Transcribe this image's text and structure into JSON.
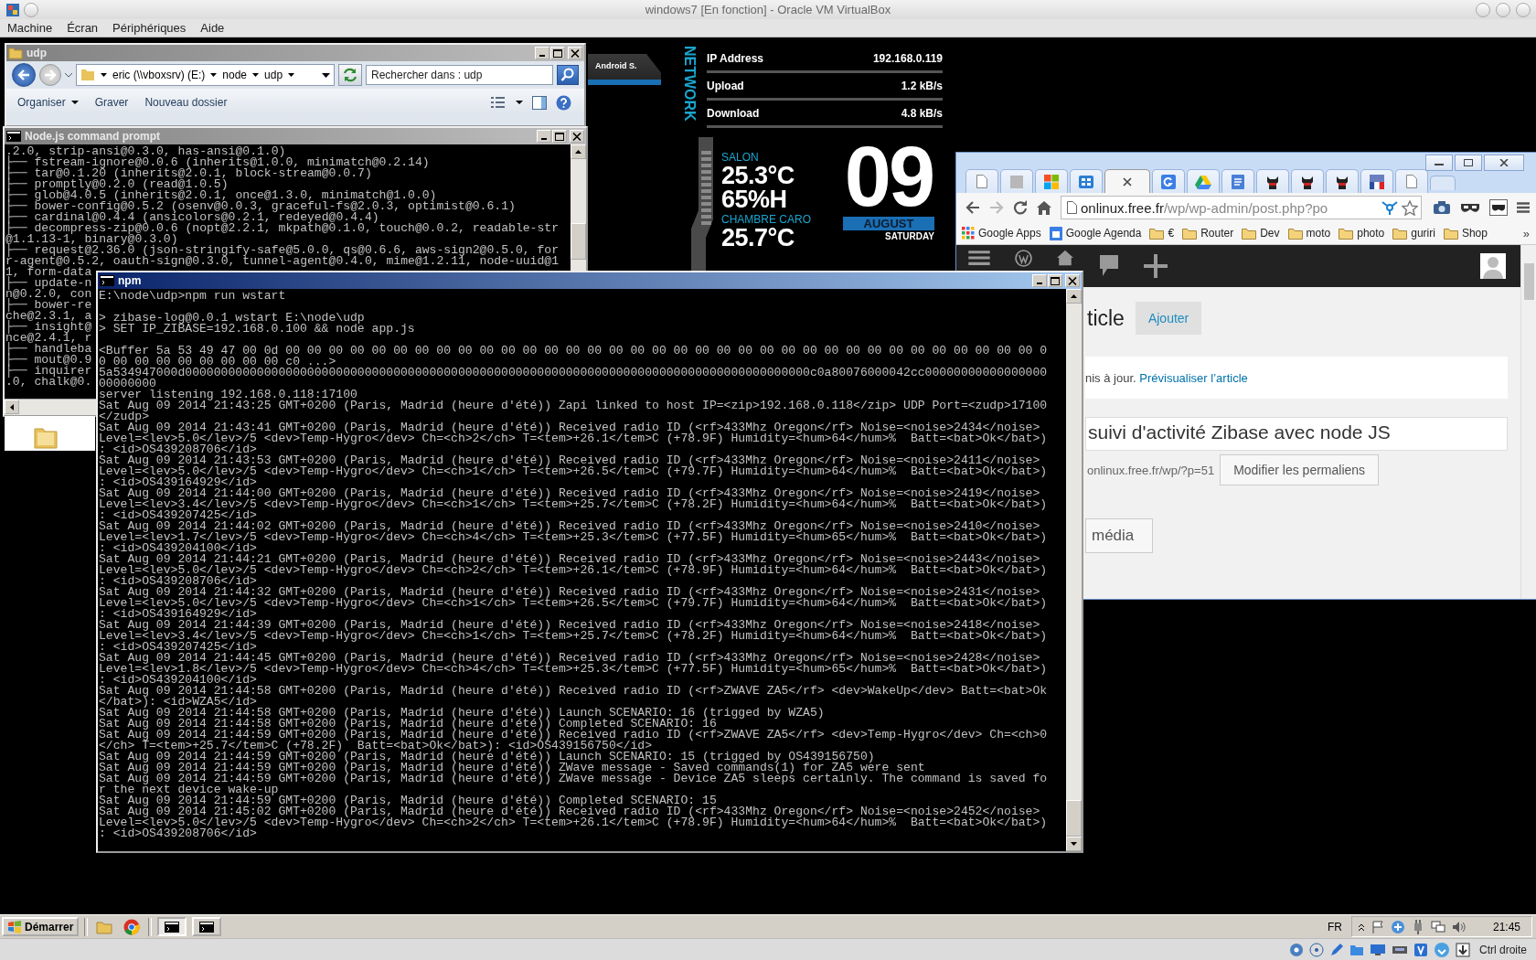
{
  "host_window": {
    "title": "windows7 [En fonction] - Oracle VM VirtualBox",
    "menu": [
      "Machine",
      "Écran",
      "Périphériques",
      "Aide"
    ]
  },
  "explorer": {
    "title": "udp",
    "breadcrumb": [
      "eric (\\\\vboxsrv) (E:)",
      "node",
      "udp"
    ],
    "search": {
      "placeholder": "Rechercher dans : udp"
    },
    "toolbar": [
      {
        "label": "Organiser",
        "dropdown": true
      },
      {
        "label": "Graver",
        "dropdown": false
      },
      {
        "label": "Nouveau dossier",
        "dropdown": false
      }
    ]
  },
  "node_prompt": {
    "title": "Node.js command prompt",
    "lines": [
      ".2.0, strip-ansi@0.3.0, has-ansi@0.1.0)",
      "├── fstream-ignore@0.0.6 (inherits@1.0.0, minimatch@0.2.14)",
      "├── tar@0.1.20 (inherits@2.0.1, block-stream@0.0.7)",
      "├── promptly@0.2.0 (read@1.0.5)",
      "├── glob@4.0.5 (inherits@2.0.1, once@1.3.0, minimatch@1.0.0)",
      "├── bower-config@0.5.2 (osenv@0.0.3, graceful-fs@2.0.3, optimist@0.6.1)",
      "├── cardinal@0.4.4 (ansicolors@0.2.1, redeyed@0.4.4)",
      "├── decompress-zip@0.0.6 (nopt@2.2.1, mkpath@0.1.0, touch@0.0.2, readable-str",
      "@1.1.13-1, binary@0.3.0)",
      "├── request@2.36.0 (json-stringify-safe@5.0.0, qs@0.6.6, aws-sign2@0.5.0, for",
      "r-agent@0.5.2, oauth-sign@0.3.0, tunnel-agent@0.4.0, mime@1.2.11, node-uuid@1",
      "1, form-data",
      "├── update-n",
      "n@0.2.0, con",
      "├── bower-re",
      "che@2.3.1, a",
      "├── insight@",
      "nce@2.4.1, r",
      "├── handleba",
      "├── mout@0.9",
      "├── inquirer",
      ".0, chalk@0."
    ]
  },
  "npm_console": {
    "title": "npm",
    "blocks": [
      [
        "E:\\node\\udp>npm run wstart"
      ],
      [
        "> zibase-log@0.0.1 wstart E:\\node\\udp",
        "> SET IP_ZIBASE=192.168.0.100 && node app.js"
      ],
      [
        "<Buffer 5a 53 49 47 00 0d 00 00 00 00 00 00 00 00 00 00 00 00 00 00 00 00 00 00 00 00 00 00 00 00 00 00 00 00 00 00 00 00 00 00 00 0",
        "0 00 00 00 00 00 00 00 00 c0 ...>",
        "5a534947000d000000000000000000000000000000000000000000000000000000000000000000000000000000000000000c0a80076000042cc00000000000000000",
        "00000000",
        "server listening 192.168.0.118:17100",
        "Sat Aug 09 2014 21:43:25 GMT+0200 (Paris, Madrid (heure d'été)) Zapi linked to host IP=<zip>192.168.0.118</zip> UDP Port=<zudp>17100",
        "</zudp>",
        "Sat Aug 09 2014 21:43:41 GMT+0200 (Paris, Madrid (heure d'été)) Received radio ID (<rf>433Mhz Oregon</rf> Noise=<noise>2434</noise>",
        "Level=<lev>5.0</lev>/5 <dev>Temp-Hygro</dev> Ch=<ch>2</ch> T=<tem>+26.1</tem>C (+78.9F) Humidity=<hum>64</hum>%  Batt=<bat>Ok</bat>)",
        ": <id>OS439208706</id>",
        "Sat Aug 09 2014 21:43:53 GMT+0200 (Paris, Madrid (heure d'été)) Received radio ID (<rf>433Mhz Oregon</rf> Noise=<noise>2411</noise>",
        "Level=<lev>5.0</lev>/5 <dev>Temp-Hygro</dev> Ch=<ch>1</ch> T=<tem>+26.5</tem>C (+79.7F) Humidity=<hum>64</hum>%  Batt=<bat>Ok</bat>)",
        ": <id>OS439164929</id>",
        "Sat Aug 09 2014 21:44:00 GMT+0200 (Paris, Madrid (heure d'été)) Received radio ID (<rf>433Mhz Oregon</rf> Noise=<noise>2419</noise>",
        "Level=<lev>3.4</lev>/5 <dev>Temp-Hygro</dev> Ch=<ch>1</ch> T=<tem>+25.7</tem>C (+78.2F) Humidity=<hum>64</hum>%  Batt=<bat>Ok</bat>)",
        ": <id>OS439207425</id>",
        "Sat Aug 09 2014 21:44:02 GMT+0200 (Paris, Madrid (heure d'été)) Received radio ID (<rf>433Mhz Oregon</rf> Noise=<noise>2410</noise>",
        "Level=<lev>1.7</lev>/5 <dev>Temp-Hygro</dev> Ch=<ch>4</ch> T=<tem>+25.3</tem>C (+77.5F) Humidity=<hum>65</hum>%  Batt=<bat>Ok</bat>)",
        ": <id>OS439204100</id>",
        "Sat Aug 09 2014 21:44:21 GMT+0200 (Paris, Madrid (heure d'été)) Received radio ID (<rf>433Mhz Oregon</rf> Noise=<noise>2443</noise>",
        "Level=<lev>5.0</lev>/5 <dev>Temp-Hygro</dev> Ch=<ch>2</ch> T=<tem>+26.1</tem>C (+78.9F) Humidity=<hum>64</hum>%  Batt=<bat>Ok</bat>)",
        ": <id>OS439208706</id>",
        "Sat Aug 09 2014 21:44:32 GMT+0200 (Paris, Madrid (heure d'été)) Received radio ID (<rf>433Mhz Oregon</rf> Noise=<noise>2431</noise>",
        "Level=<lev>5.0</lev>/5 <dev>Temp-Hygro</dev> Ch=<ch>1</ch> T=<tem>+26.5</tem>C (+79.7F) Humidity=<hum>64</hum>%  Batt=<bat>Ok</bat>)",
        ": <id>OS439164929</id>",
        "Sat Aug 09 2014 21:44:39 GMT+0200 (Paris, Madrid (heure d'été)) Received radio ID (<rf>433Mhz Oregon</rf> Noise=<noise>2418</noise>",
        "Level=<lev>3.4</lev>/5 <dev>Temp-Hygro</dev> Ch=<ch>1</ch> T=<tem>+25.7</tem>C (+78.2F) Humidity=<hum>64</hum>%  Batt=<bat>Ok</bat>)",
        ": <id>OS439207425</id>",
        "Sat Aug 09 2014 21:44:45 GMT+0200 (Paris, Madrid (heure d'été)) Received radio ID (<rf>433Mhz Oregon</rf> Noise=<noise>2428</noise>",
        "Level=<lev>1.8</lev>/5 <dev>Temp-Hygro</dev> Ch=<ch>4</ch> T=<tem>+25.3</tem>C (+77.5F) Humidity=<hum>65</hum>%  Batt=<bat>Ok</bat>)",
        ": <id>OS439204100</id>",
        "Sat Aug 09 2014 21:44:58 GMT+0200 (Paris, Madrid (heure d'été)) Received radio ID (<rf>ZWAVE ZA5</rf> <dev>WakeUp</dev> Batt=<bat>Ok",
        "</bat>): <id>WZA5</id>",
        "Sat Aug 09 2014 21:44:58 GMT+0200 (Paris, Madrid (heure d'été)) Launch SCENARIO: 16 (trigged by WZA5)",
        "Sat Aug 09 2014 21:44:58 GMT+0200 (Paris, Madrid (heure d'été)) Completed SCENARIO: 16",
        "Sat Aug 09 2014 21:44:59 GMT+0200 (Paris, Madrid (heure d'été)) Received radio ID (<rf>ZWAVE ZA5</rf> <dev>Temp-Hygro</dev> Ch=<ch>0",
        "</ch> T=<tem>+25.7</tem>C (+78.2F)  Batt=<bat>Ok</bat>): <id>OS439156750</id>",
        "Sat Aug 09 2014 21:44:59 GMT+0200 (Paris, Madrid (heure d'été)) Launch SCENARIO: 15 (trigged by OS439156750)",
        "Sat Aug 09 2014 21:44:59 GMT+0200 (Paris, Madrid (heure d'été)) ZWave message - Saved commands(1) for ZA5 were sent",
        "Sat Aug 09 2014 21:44:59 GMT+0200 (Paris, Madrid (heure d'été)) ZWave message - Device ZA5 sleeps certainly. The command is saved fo",
        "r the next device wake-up",
        "Sat Aug 09 2014 21:44:59 GMT+0200 (Paris, Madrid (heure d'été)) Completed SCENARIO: 15",
        "Sat Aug 09 2014 21:45:02 GMT+0200 (Paris, Madrid (heure d'été)) Received radio ID (<rf>433Mhz Oregon</rf> Noise=<noise>2452</noise>",
        "Level=<lev>5.0</lev>/5 <dev>Temp-Hygro</dev> Ch=<ch>2</ch> T=<tem>+26.1</tem>C (+78.9F) Humidity=<hum>64</hum>%  Batt=<bat>Ok</bat>)",
        ": <id>OS439208706</id>"
      ]
    ]
  },
  "device_tag": "Android S.",
  "network_widget": {
    "heading": "NETWORK",
    "rows": [
      {
        "label": "IP Address",
        "value": "192.168.0.119"
      },
      {
        "label": "Upload",
        "value": "1.2 kB/s"
      },
      {
        "label": "Download",
        "value": "4.8 kB/s"
      }
    ]
  },
  "weather_widget": {
    "rooms": [
      {
        "name": "SALON",
        "temperature": "25.3°C",
        "humidity": "65%H"
      },
      {
        "name": "CHAMBRE CARO",
        "temperature": "25.7°C"
      }
    ]
  },
  "date_widget": {
    "day": "09",
    "month": "AUGUST",
    "weekday": "SATURDAY"
  },
  "browser": {
    "tabs": [
      {
        "kind": "page",
        "selected": false
      },
      {
        "kind": "square",
        "selected": false
      },
      {
        "kind": "windows",
        "selected": false
      },
      {
        "kind": "grid",
        "selected": false
      },
      {
        "selected": true
      },
      {
        "kind": "tile",
        "selected": false
      },
      {
        "kind": "triangle",
        "selected": false
      },
      {
        "kind": "document",
        "selected": false
      },
      {
        "kind": "figure",
        "selected": false
      },
      {
        "kind": "figure",
        "selected": false
      },
      {
        "kind": "figure",
        "selected": false
      },
      {
        "kind": "flag",
        "selected": false
      },
      {
        "kind": "page",
        "selected": false
      }
    ],
    "address": {
      "host": "onlinux.free.fr",
      "path": "/wp/wp-admin/post.php?po"
    },
    "bookmarks": [
      {
        "kind": "apps",
        "label": "Google Apps"
      },
      {
        "kind": "calendar",
        "label": "Google Agenda"
      },
      {
        "kind": "folder",
        "label": "€"
      },
      {
        "kind": "folder",
        "label": "Router"
      },
      {
        "kind": "folder",
        "label": "Dev"
      },
      {
        "kind": "folder",
        "label": "moto"
      },
      {
        "kind": "folder",
        "label": "photo"
      },
      {
        "kind": "folder",
        "label": "guriri"
      },
      {
        "kind": "folder",
        "label": "Shop"
      }
    ],
    "bookmarks_more": "»",
    "page": {
      "heading": "ticle",
      "add_button": "Ajouter",
      "notice": "nis à jour. ",
      "notice_link": "Prévisualiser l’article",
      "post_title": "suivi d'activité Zibase avec node JS",
      "permalink": "onlinux.free.fr/wp/?p=51",
      "permalink_button": "Modifier les permaliens",
      "media_button": "média"
    }
  },
  "taskbar": {
    "start": "Démarrer",
    "quick_launch": [
      {
        "kind": "folder"
      },
      {
        "kind": "browser"
      }
    ],
    "tasks": [
      {
        "kind": "console",
        "selected": true
      },
      {
        "kind": "console",
        "selected": false
      }
    ],
    "language": "FR",
    "clock": "21:45"
  },
  "status_bar": {
    "host_key": "Ctrl droite"
  }
}
